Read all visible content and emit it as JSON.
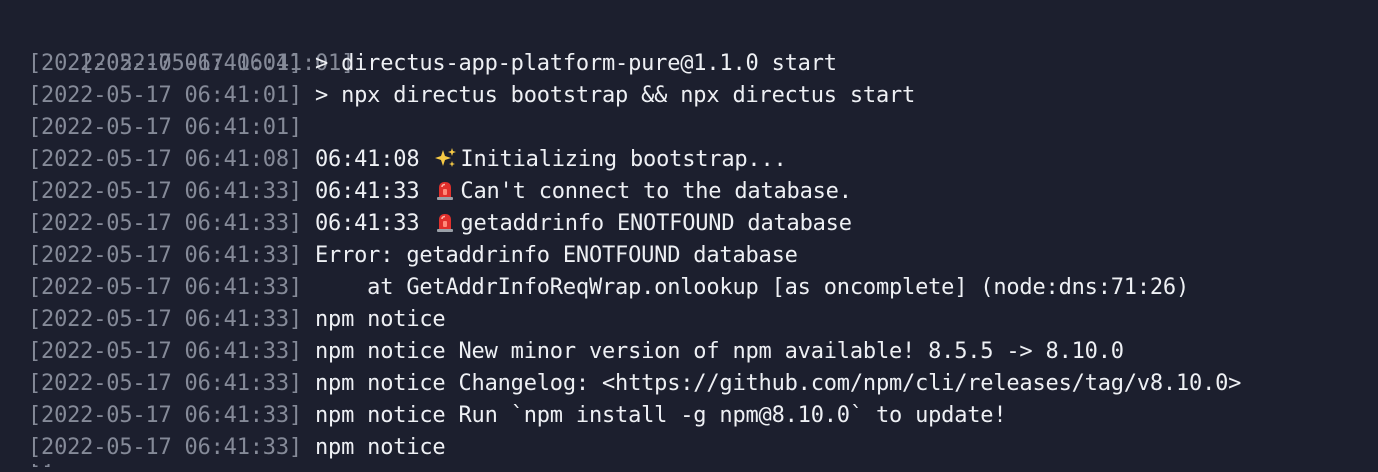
{
  "terminal": {
    "lines": [
      {
        "timestamp": "[2022-05-17 06:41:01]",
        "message": ""
      },
      {
        "timestamp": "[2022-05-17 06:41:01]",
        "message": "> directus-app-platform-pure@1.1.0 start"
      },
      {
        "timestamp": "[2022-05-17 06:41:01]",
        "message": "> npx directus bootstrap && npx directus start"
      },
      {
        "timestamp": "[2022-05-17 06:41:01]",
        "message": ""
      },
      {
        "timestamp": "[2022-05-17 06:41:08]",
        "prefix": "06:41:08",
        "icon": "sparkles-icon",
        "message": "Initializing bootstrap..."
      },
      {
        "timestamp": "[2022-05-17 06:41:33]",
        "prefix": "06:41:33",
        "icon": "siren-icon",
        "message": "Can't connect to the database."
      },
      {
        "timestamp": "[2022-05-17 06:41:33]",
        "prefix": "06:41:33",
        "icon": "siren-icon",
        "message": "getaddrinfo ENOTFOUND database"
      },
      {
        "timestamp": "[2022-05-17 06:41:33]",
        "message": "Error: getaddrinfo ENOTFOUND database"
      },
      {
        "timestamp": "[2022-05-17 06:41:33]",
        "message": "    at GetAddrInfoReqWrap.onlookup [as oncomplete] (node:dns:71:26)"
      },
      {
        "timestamp": "[2022-05-17 06:41:33]",
        "message": "npm notice"
      },
      {
        "timestamp": "[2022-05-17 06:41:33]",
        "message": "npm notice New minor version of npm available! 8.5.5 -> 8.10.0"
      },
      {
        "timestamp": "[2022-05-17 06:41:33]",
        "message": "npm notice Changelog: <https://github.com/npm/cli/releases/tag/v8.10.0>"
      },
      {
        "timestamp": "[2022-05-17 06:41:33]",
        "message": "npm notice Run `npm install -g npm@8.10.0` to update!"
      },
      {
        "timestamp": "[2022-05-17 06:41:33]",
        "message": "npm notice"
      }
    ],
    "partial_line": "[]"
  },
  "colors": {
    "background": "#1c1f2e",
    "timestamp": "#858a98",
    "text": "#eef0f4"
  }
}
